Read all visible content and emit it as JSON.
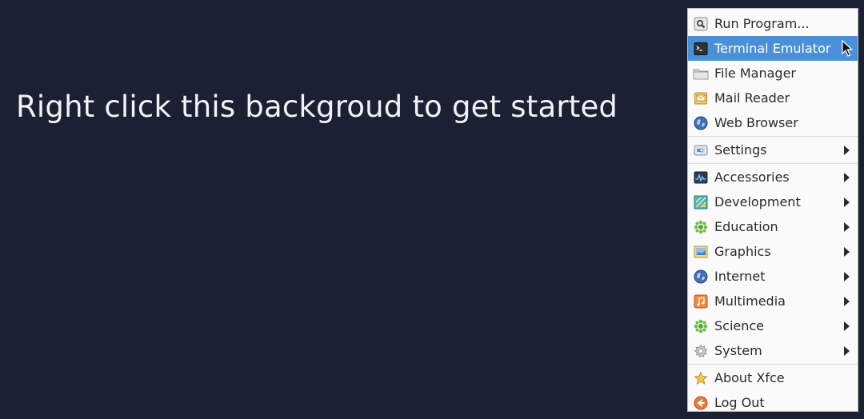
{
  "desktop": {
    "hint_text": "Right click this backgroud to get started"
  },
  "menu": {
    "items": [
      {
        "label": "Run Program...",
        "icon": "run-program-icon"
      },
      {
        "label": "Terminal Emulator",
        "icon": "terminal-icon",
        "highlighted": true
      },
      {
        "label": "File Manager",
        "icon": "folder-icon"
      },
      {
        "label": "Mail Reader",
        "icon": "mail-icon"
      },
      {
        "label": "Web Browser",
        "icon": "globe-icon"
      },
      {
        "label": "Settings",
        "icon": "settings-icon",
        "submenu": true
      },
      {
        "label": "Accessories",
        "icon": "accessories-icon",
        "submenu": true
      },
      {
        "label": "Development",
        "icon": "development-icon",
        "submenu": true
      },
      {
        "label": "Education",
        "icon": "education-icon",
        "submenu": true
      },
      {
        "label": "Graphics",
        "icon": "graphics-icon",
        "submenu": true
      },
      {
        "label": "Internet",
        "icon": "internet-icon",
        "submenu": true
      },
      {
        "label": "Multimedia",
        "icon": "multimedia-icon",
        "submenu": true
      },
      {
        "label": "Science",
        "icon": "science-icon",
        "submenu": true
      },
      {
        "label": "System",
        "icon": "system-icon",
        "submenu": true
      },
      {
        "label": "About Xfce",
        "icon": "star-icon"
      },
      {
        "label": "Log Out",
        "icon": "log-out-icon"
      }
    ]
  },
  "colors": {
    "desktop_background": "#1b2133",
    "menu_background": "#fafafa",
    "highlight": "#4a90d9"
  }
}
